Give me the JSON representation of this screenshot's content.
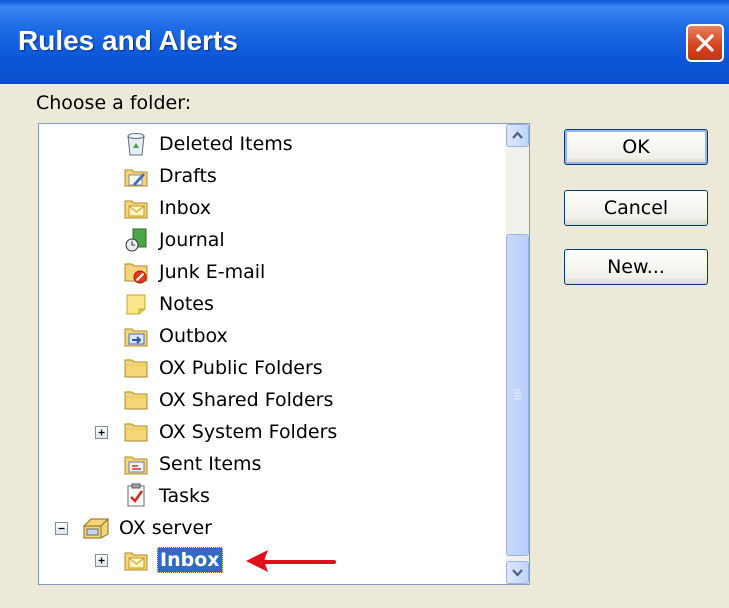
{
  "window": {
    "title": "Rules and Alerts"
  },
  "prompt": "Choose a folder:",
  "buttons": {
    "ok": "OK",
    "cancel": "Cancel",
    "new": "New..."
  },
  "tree": [
    {
      "label": "Deleted Items",
      "icon": "deleted-items-icon"
    },
    {
      "label": "Drafts",
      "icon": "drafts-icon"
    },
    {
      "label": "Inbox",
      "icon": "inbox-icon"
    },
    {
      "label": "Journal",
      "icon": "journal-icon"
    },
    {
      "label": "Junk E-mail",
      "icon": "junk-email-icon"
    },
    {
      "label": "Notes",
      "icon": "notes-icon"
    },
    {
      "label": "Outbox",
      "icon": "outbox-icon"
    },
    {
      "label": "OX Public Folders",
      "icon": "folder-icon"
    },
    {
      "label": "OX Shared Folders",
      "icon": "folder-icon"
    },
    {
      "label": "OX System Folders",
      "icon": "folder-icon",
      "expander": "+"
    },
    {
      "label": "Sent Items",
      "icon": "sent-items-icon"
    },
    {
      "label": "Tasks",
      "icon": "tasks-icon"
    },
    {
      "label": "OX server",
      "icon": "mailbox-icon",
      "expander": "-"
    },
    {
      "label": "Inbox",
      "icon": "inbox-icon",
      "expander": "+",
      "selected": true
    }
  ],
  "colors": {
    "titlebar": "#0a56d8",
    "selection": "#316ac5",
    "annotation_arrow": "#e0101a"
  }
}
